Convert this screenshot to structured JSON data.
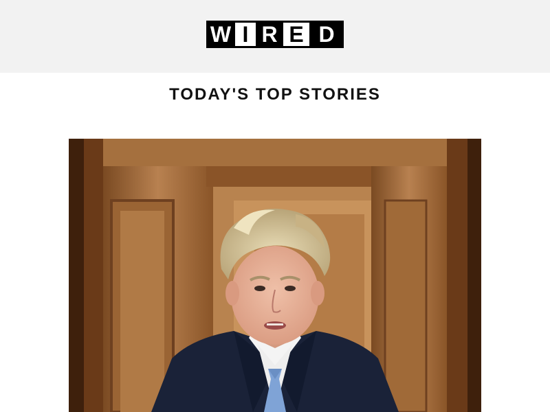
{
  "header": {
    "logo_letters": [
      "W",
      "I",
      "R",
      "E",
      "D"
    ],
    "logo_label": "WIRED",
    "background": "#f2f2f2"
  },
  "section": {
    "title": "TODAY'S TOP STORIES"
  },
  "hero_image": {
    "icon": "photo-of-man-in-wood-paneled-room",
    "palette": {
      "wood_dark": "#5a3217",
      "wood_mid": "#9a6231",
      "wood_light": "#c89460",
      "hair": "#d9c9a0",
      "skin": "#e6b39c",
      "suit": "#1a2238",
      "shirt": "#f2f2f2",
      "tie": "#7fa3d6"
    }
  }
}
